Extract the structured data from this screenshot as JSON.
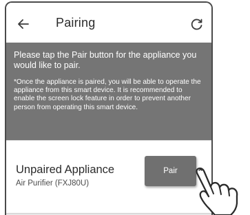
{
  "header": {
    "title": "Pairing",
    "back_icon": "arrow-left-icon",
    "refresh_icon": "refresh-icon"
  },
  "info": {
    "main": "Please tap the Pair button for the appliance you would like to pair.",
    "note": "*Once the appliance is paired, you will be able to operate the appliance from this smart device. It is recommended to enable the screen lock feature in order to prevent another person from operating this smart device."
  },
  "device": {
    "name": "Unpaired Appliance",
    "model": "Air Purifier (FXJ80U)",
    "pair_label": "Pair"
  },
  "colors": {
    "panel": "#757575",
    "button": "#707070",
    "text": "#2b2b2b"
  },
  "overlay": {
    "icon": "tapping-hand-icon"
  }
}
